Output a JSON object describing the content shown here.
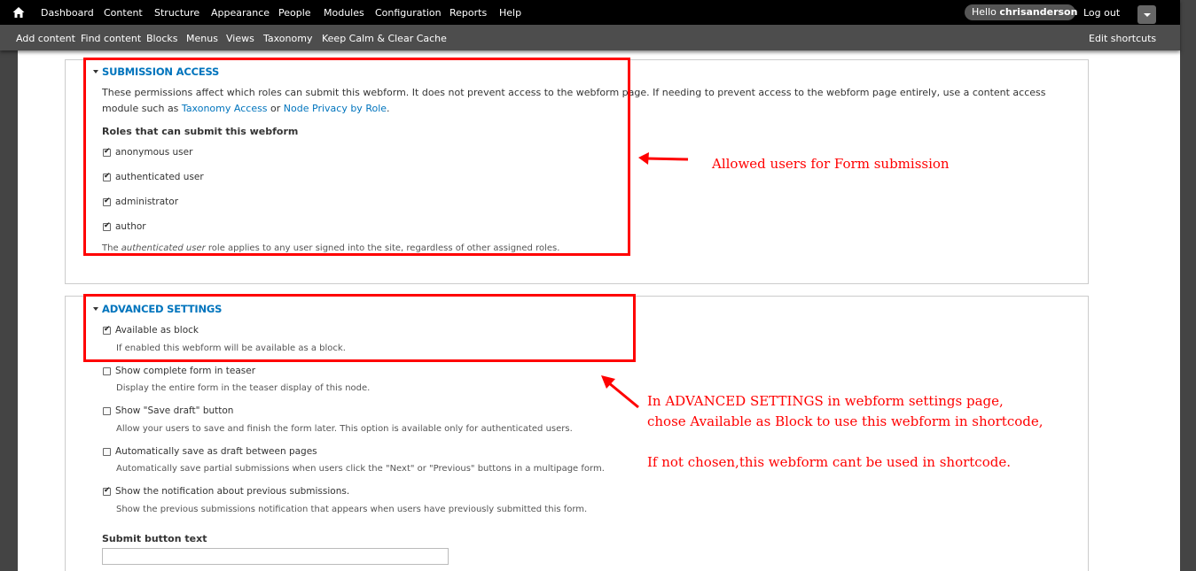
{
  "toolbar": {
    "menu": [
      "Dashboard",
      "Content",
      "Structure",
      "Appearance",
      "People",
      "Modules",
      "Configuration",
      "Reports",
      "Help"
    ],
    "hello_prefix": "Hello ",
    "username": "chrisanderson",
    "logout": "Log out",
    "shortcuts": [
      "Add content",
      "Find content",
      "Blocks",
      "Menus",
      "Views",
      "Taxonomy",
      "Keep Calm & Clear Cache"
    ],
    "edit_shortcuts": "Edit shortcuts"
  },
  "submission_access": {
    "legend": "SUBMISSION ACCESS",
    "desc_line1": "These permissions affect which roles can submit this webform. It does not prevent access to the webform page. If needing to prevent access to the webform page entirely, use a content access",
    "desc_line2_prefix": "module such as ",
    "link1": "Taxonomy Access",
    "desc_or": " or ",
    "link2": "Node Privacy by Role",
    "desc_end": ".",
    "roles_heading": "Roles that can submit this webform",
    "roles": [
      {
        "label": "anonymous user",
        "checked": true
      },
      {
        "label": "authenticated user",
        "checked": true
      },
      {
        "label": "administrator",
        "checked": true
      },
      {
        "label": "author",
        "checked": true
      }
    ],
    "note_prefix": "The ",
    "note_em": "authenticated user",
    "note_suffix": " role applies to any user signed into the site, regardless of other assigned roles."
  },
  "advanced_settings": {
    "legend": "ADVANCED SETTINGS",
    "options": [
      {
        "label": "Available as block",
        "desc": "If enabled this webform will be available as a block.",
        "checked": true
      },
      {
        "label": "Show complete form in teaser",
        "desc": "Display the entire form in the teaser display of this node.",
        "checked": false
      },
      {
        "label": "Show \"Save draft\" button",
        "desc": "Allow your users to save and finish the form later. This option is available only for authenticated users.",
        "checked": false
      },
      {
        "label": "Automatically save as draft between pages",
        "desc": "Automatically save partial submissions when users click the \"Next\" or \"Previous\" buttons in a multipage form.",
        "checked": false
      },
      {
        "label": "Show the notification about previous submissions.",
        "desc": "Show the previous submissions notification that appears when users have previously submitted this form.",
        "checked": true
      }
    ],
    "submit_heading": "Submit button text",
    "submit_value": ""
  },
  "annotations": {
    "allowed_users": "Allowed users for Form submission",
    "advanced_line1": "In ADVANCED SETTINGS in webform settings page,",
    "advanced_line2": "chose Available as Block to use this webform in shortcode,",
    "advanced_line3": "If not chosen,this webform cant be used in shortcode.",
    "color": "#ff0000"
  }
}
